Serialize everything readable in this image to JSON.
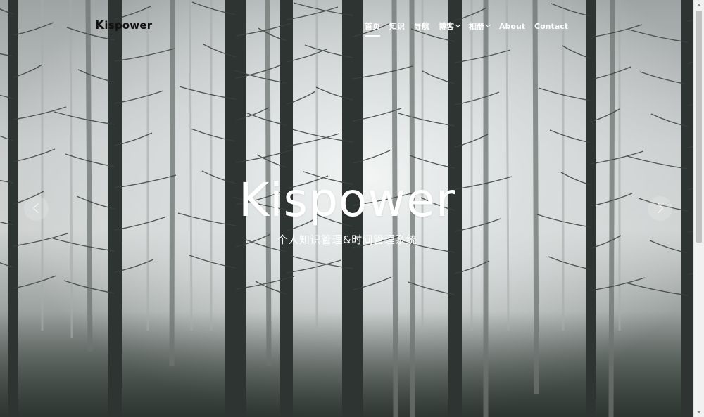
{
  "navbar": {
    "logo_initial": "K",
    "logo_rest": "ispower",
    "items": [
      {
        "label": "首页",
        "active": true,
        "dropdown": false
      },
      {
        "label": "知识",
        "active": false,
        "dropdown": false
      },
      {
        "label": "导航",
        "active": false,
        "dropdown": false
      },
      {
        "label": "博客",
        "active": false,
        "dropdown": true
      },
      {
        "label": "相册",
        "active": false,
        "dropdown": true
      },
      {
        "label": "About",
        "active": false,
        "dropdown": false
      },
      {
        "label": "Contact",
        "active": false,
        "dropdown": false
      }
    ]
  },
  "hero": {
    "title": "Kispower",
    "subtitle": "个人知识管理&时间管理系统",
    "prev_icon": "chevron-left-icon",
    "next_icon": "chevron-right-icon"
  },
  "colors": {
    "nav_text": "#ffffff",
    "logo_text": "#111111",
    "hero_text": "#ffffff"
  }
}
